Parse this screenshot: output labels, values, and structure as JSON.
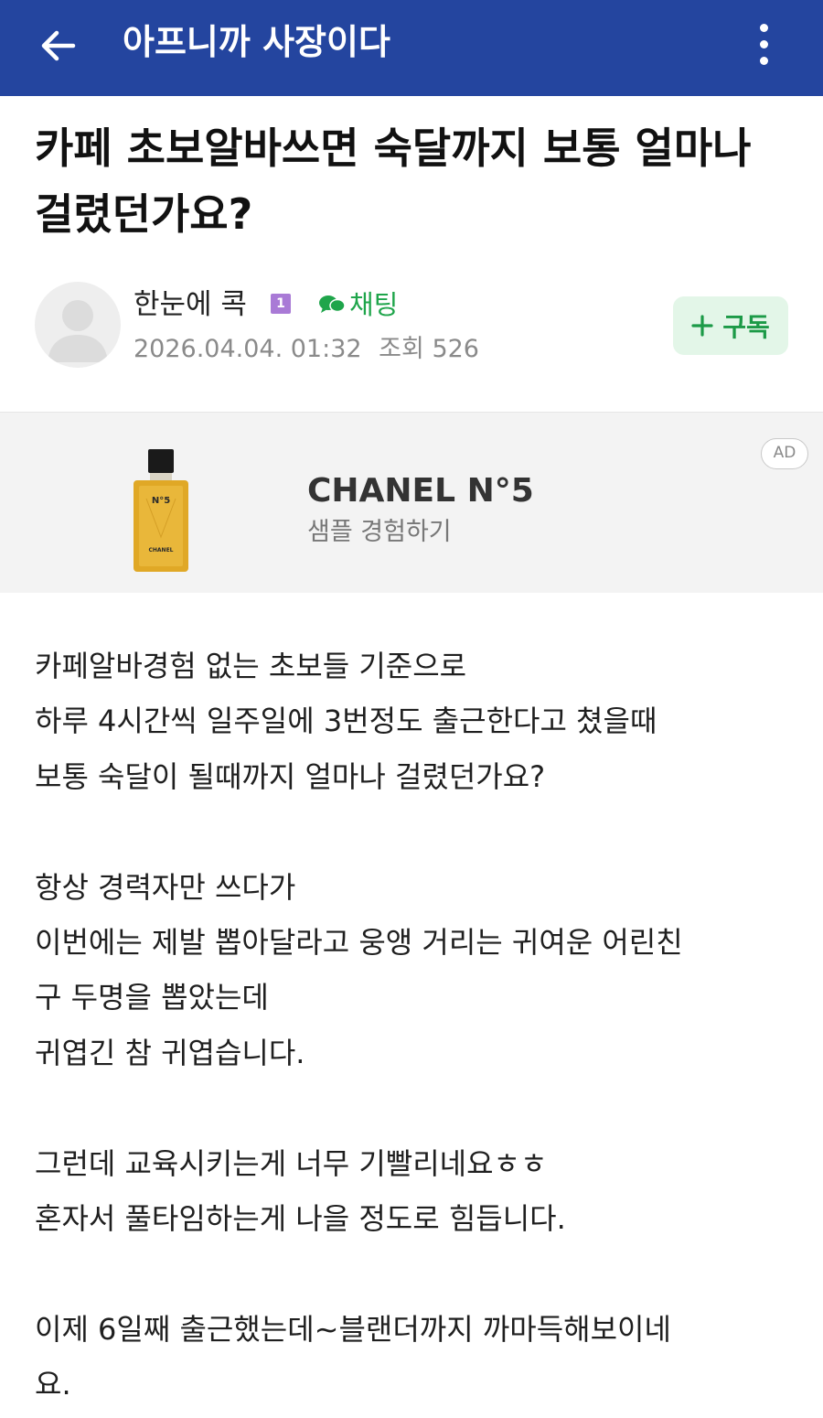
{
  "appbar": {
    "title": "아프니까 사장이다",
    "back_icon": "arrow-left-icon",
    "more_icon": "more-vertical-icon",
    "background_color": "#24459f"
  },
  "post": {
    "title": "카페 초보알바쓰면 숙달까지 보통 얼마나 걸렸던가요?"
  },
  "author": {
    "name": "한눈에 콕",
    "level": "1",
    "chat_label": "채팅",
    "datetime": "2026.04.04. 01:32",
    "views_label": "조회",
    "views": "526",
    "subscribe_label": "구독",
    "accent_color": "#1fa54b"
  },
  "ad": {
    "badge": "AD",
    "brand": "CHANEL N°5",
    "cta": "샘플 경험하기",
    "product_label": "N°5",
    "product_brand": "CHANEL"
  },
  "content": {
    "paragraphs": [
      [
        "카페알바경험 없는 초보들 기준으로",
        "하루 4시간씩 일주일에 3번정도 출근한다고 쳤을때",
        "보통 숙달이 될때까지 얼마나 걸렸던가요?"
      ],
      [
        "항상 경력자만 쓰다가",
        "이번에는 제발 뽑아달라고 웅앵 거리는 귀여운 어린친",
        "구 두명을 뽑았는데",
        "귀엽긴 참 귀엽습니다."
      ],
      [
        "그런데 교육시키는게 너무 기빨리네요ㅎㅎ",
        "혼자서 풀타임하는게 나을 정도로 힘듭니다."
      ],
      [
        "이제 6일째 출근했는데~블랜더까지 까마득해보이네",
        "요."
      ]
    ]
  }
}
